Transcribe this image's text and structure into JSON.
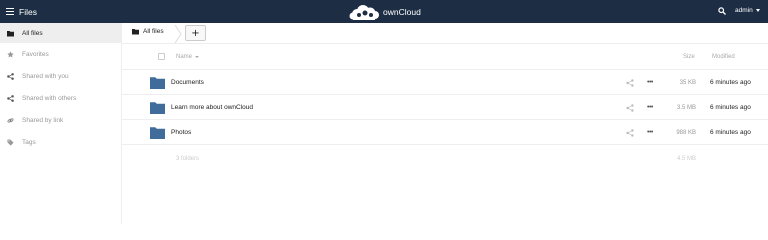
{
  "header": {
    "app_title": "Files",
    "logo_text": "ownCloud",
    "user_name": "admin",
    "bg_color": "#1d2d44"
  },
  "sidebar": {
    "items": [
      {
        "label": "All files",
        "icon": "folder-icon",
        "active": true
      },
      {
        "label": "Favorites",
        "icon": "star-icon"
      },
      {
        "label": "Shared with you",
        "icon": "share-icon"
      },
      {
        "label": "Shared with others",
        "icon": "share-icon"
      },
      {
        "label": "Shared by link",
        "icon": "link-icon"
      },
      {
        "label": "Tags",
        "icon": "tag-icon"
      }
    ]
  },
  "breadcrumb": {
    "label": "All files",
    "new_button": "+"
  },
  "file_list": {
    "columns": {
      "name": "Name",
      "size": "Size",
      "modified": "Modified"
    },
    "rows": [
      {
        "name": "Documents",
        "size": "35 KB",
        "modified": "6 minutes ago"
      },
      {
        "name": "Learn more about ownCloud",
        "size": "3.5 MB",
        "modified": "6 minutes ago"
      },
      {
        "name": "Photos",
        "size": "988 KB",
        "modified": "6 minutes ago"
      }
    ],
    "summary": {
      "count": "3 folders",
      "total_size": "4.5 MB"
    }
  },
  "icons": {
    "more_actions": "•••"
  }
}
